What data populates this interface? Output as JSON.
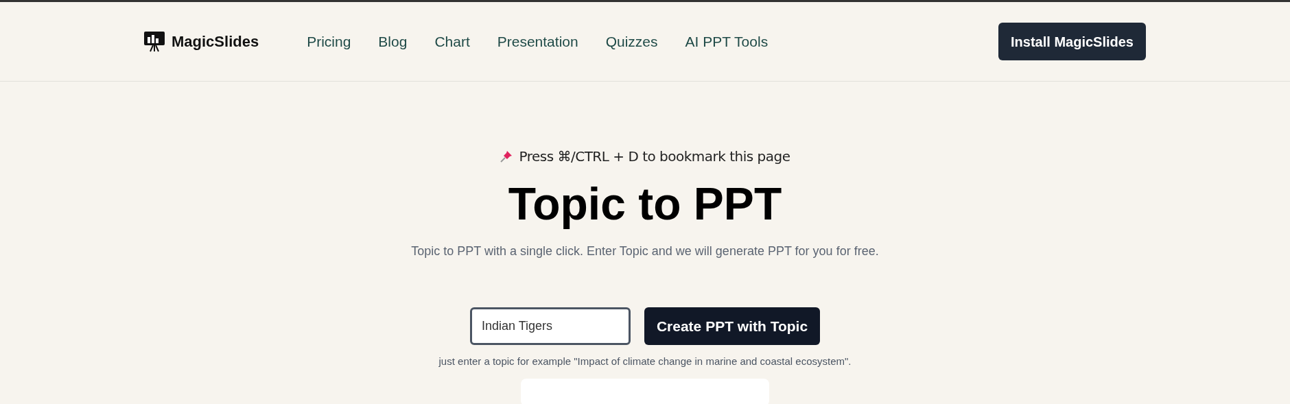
{
  "header": {
    "logo": "MagicSlides",
    "nav": [
      "Pricing",
      "Blog",
      "Chart",
      "Presentation",
      "Quizzes",
      "AI PPT Tools"
    ],
    "cta": "Install MagicSlides"
  },
  "hero": {
    "bookmark_tip": "Press ⌘/CTRL + D to bookmark this page",
    "title": "Topic to PPT",
    "subtitle": "Topic to PPT with a single click. Enter Topic and we will generate PPT for you for free.",
    "topic_input": {
      "value": "Indian Tigers"
    },
    "submit": "Create PPT with Topic",
    "hint": "just enter a topic for example \"Impact of climate change in marine and coastal ecosystem\"."
  }
}
